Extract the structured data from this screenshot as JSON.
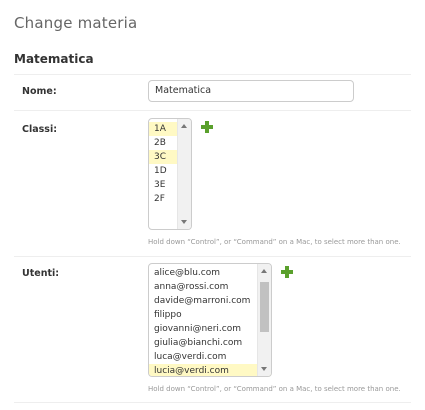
{
  "page_title": "Change materia",
  "section_title": "Matematica",
  "fields": {
    "nome": {
      "label": "Nome:",
      "value": "Matematica"
    },
    "classi": {
      "label": "Classi:",
      "options": [
        {
          "label": "1A",
          "selected": true
        },
        {
          "label": "2B",
          "selected": false
        },
        {
          "label": "3C",
          "selected": true
        },
        {
          "label": "1D",
          "selected": false
        },
        {
          "label": "3E",
          "selected": false
        },
        {
          "label": "2F",
          "selected": false
        }
      ],
      "add_icon": "plus-icon",
      "help": "Hold down “Control”, or “Command” on a Mac, to select more than one."
    },
    "utenti": {
      "label": "Utenti:",
      "options": [
        {
          "label": "alice@blu.com",
          "selected": false
        },
        {
          "label": "anna@rossi.com",
          "selected": false
        },
        {
          "label": "davide@marroni.com",
          "selected": false
        },
        {
          "label": "filippo",
          "selected": false
        },
        {
          "label": "giovanni@neri.com",
          "selected": false
        },
        {
          "label": "giulia@bianchi.com",
          "selected": false
        },
        {
          "label": "luca@verdi.com",
          "selected": false
        },
        {
          "label": "lucia@verdi.com",
          "selected": true
        }
      ],
      "add_icon": "plus-icon",
      "help": "Hold down “Control”, or “Command” on a Mac, to select more than one."
    }
  },
  "colors": {
    "selected_option": "#fff9c4",
    "add_icon": "#5aa02c",
    "help_text": "#999999"
  }
}
